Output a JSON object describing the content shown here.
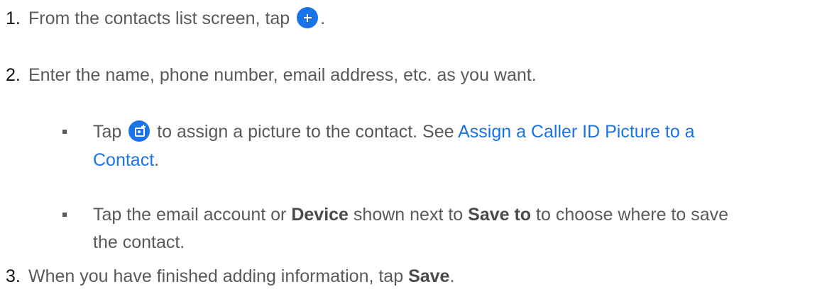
{
  "steps": [
    {
      "number": "1.",
      "text_before": "From the contacts list screen, tap",
      "text_after": ".",
      "icon": "add-contact-plus-icon"
    },
    {
      "number": "2.",
      "text": "Enter the name, phone number, email address, etc. as you want.",
      "bullets": [
        {
          "prefix": "Tap",
          "icon": "add-photo-camera-icon",
          "middle": "to assign a picture to the contact. See",
          "link_part1": "Assign a Caller ID Picture to a",
          "link_part2": "Contact",
          "suffix": "."
        },
        {
          "part1": "Tap the email account or",
          "bold1": "Device",
          "part2": "shown next to",
          "bold2": "Save to",
          "part3": "to choose where to save",
          "part4": "the contact."
        }
      ]
    },
    {
      "number": "3.",
      "text_before": "When you have finished adding information, tap",
      "bold": "Save",
      "text_after": "."
    }
  ],
  "colors": {
    "text": "#595959",
    "link": "#1a73e8",
    "icon_button": "#1a73e8"
  }
}
